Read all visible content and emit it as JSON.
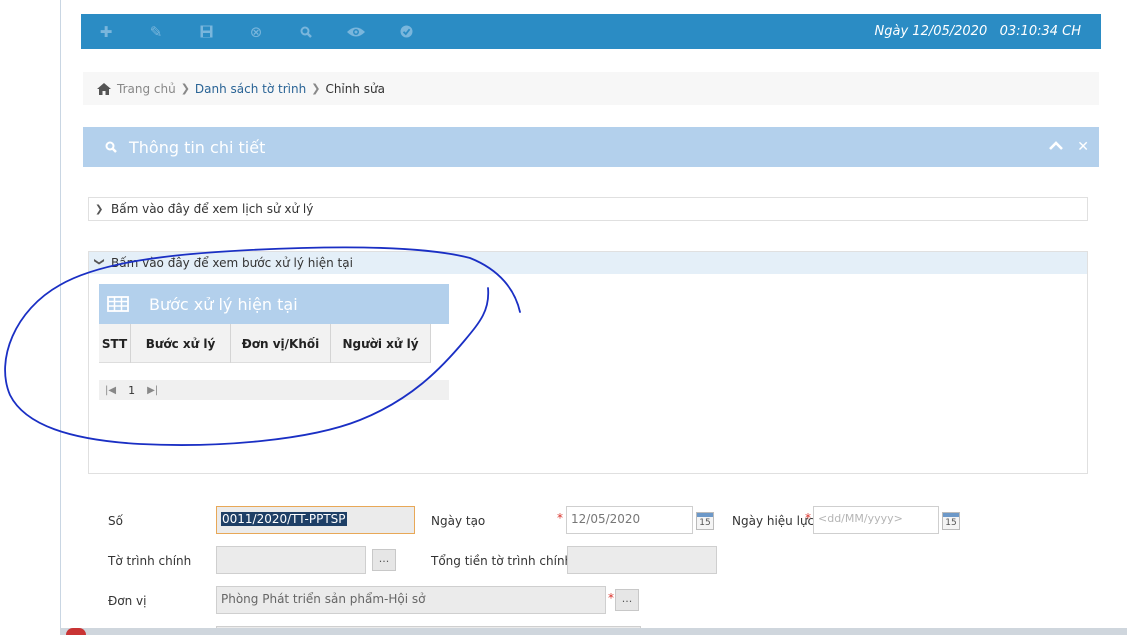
{
  "toolbar": {
    "datetime": "Ngày 12/05/2020   03:10:34 CH",
    "icons": [
      "plus-icon",
      "pencil-icon",
      "save-icon",
      "cancel-icon",
      "search-icon",
      "eye-icon",
      "check-icon"
    ]
  },
  "breadcrumb": {
    "home": "Trang chủ",
    "list": "Danh sách tờ trình",
    "current": "Chỉnh sửa"
  },
  "panel": {
    "title": "Thông tin chi tiết"
  },
  "accordion": {
    "history": "Bấm vào đây để xem lịch sử xử lý",
    "current_step": "Bấm vào đây để xem bước xử lý hiện tại"
  },
  "grid": {
    "title": "Bước xử lý hiện tại",
    "columns": [
      "STT",
      "Bước xử lý",
      "Đơn vị/Khối",
      "Người xử lý"
    ],
    "page": "1"
  },
  "form": {
    "so_label": "Số",
    "so_value": "0011/2020/TT-PPTSP",
    "ngay_tao_label": "Ngày tạo",
    "ngay_tao_value": "12/05/2020",
    "ngay_hieu_luc_label": "Ngày hiệu lực",
    "ngay_hieu_luc_placeholder": "<dd/MM/yyyy>",
    "to_trinh_chinh_label": "Tờ trình chính",
    "tong_tien_label": "Tổng tiền tờ trình chính",
    "don_vi_label": "Đơn vị",
    "don_vi_value": "Phòng Phát triển sản phẩm-Hội sở",
    "required_mark": "*",
    "dots": "...",
    "cal_day": "15"
  },
  "colors": {
    "toolbar": "#2b8cc4",
    "panel_header": "#b3d0ec",
    "annotation": "#1a2fc4",
    "required": "#d9332b"
  }
}
